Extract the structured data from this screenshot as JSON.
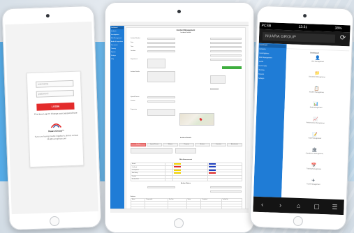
{
  "login": {
    "username_placeholder": "username",
    "password_placeholder": "password",
    "login_button": "LOGIN",
    "forgot_text": "First time Log in? Change your password here",
    "brand": "Nuara Group™",
    "note": "If you are having trouble logging in, please contact info@nuaragroup.com"
  },
  "center": {
    "header_title": "Incident Management",
    "subheader": "Incident Details",
    "sidebar_items": [
      "Dashboard",
      "Incidents",
      "Investigations",
      "Risk Management",
      "Audits & Inspections",
      "Documents",
      "Training",
      "Reports",
      "Settings",
      "Help"
    ],
    "form_labels": [
      "Incident Number",
      "Date",
      "Time",
      "Location",
      "Department",
      "Incident Details",
      "Injured Person",
      "Position",
      "Supervisor"
    ],
    "section_details": "Incident Details",
    "tabs": [
      "Incident",
      "Injured Person",
      "Witness",
      "Property",
      "Actions",
      "Corrective",
      "Attachments"
    ],
    "risk_title": "Risk Assessment",
    "risk_rows": [
      "Hazard",
      "Likelihood",
      "Consequence",
      "Risk Rating",
      "Controls",
      "Residual Risk"
    ],
    "actions_title": "Action Status",
    "bottom_table_title": "Actions",
    "bottom_cols": [
      "Action",
      "Responsible",
      "Due Date",
      "Status",
      "Completed",
      "Verified By"
    ]
  },
  "right": {
    "status_time": "13:31",
    "status_carrier": "PCSB",
    "status_battery": "38%",
    "url": "NUARA GROUP",
    "sidebar_items": [
      "Dashboard",
      "Incidents",
      "Investigations",
      "Risk Management",
      "Audits",
      "Documents",
      "Training",
      "Reports",
      "Settings"
    ],
    "main_title": "Dashboard",
    "modules": [
      {
        "icon": "👤",
        "label": "User Management"
      },
      {
        "icon": "📁",
        "label": "Document Management"
      },
      {
        "icon": "📋",
        "label": "Incident Management"
      },
      {
        "icon": "📊",
        "label": "Risk Management"
      },
      {
        "icon": "📈",
        "label": "Performance Management"
      },
      {
        "icon": "📝",
        "label": "Audit Management"
      },
      {
        "icon": "🏛",
        "label": "Compliance Management"
      },
      {
        "icon": "📅",
        "label": "Training Management"
      },
      {
        "icon": "✈",
        "label": "Travel Management"
      }
    ],
    "nav": [
      "‹",
      "›",
      "⌂",
      "▢",
      "☰"
    ]
  },
  "colors": {
    "brand_blue": "#1f7cd6",
    "login_red": "#e32b2b",
    "status_green": "#3fae3f"
  }
}
